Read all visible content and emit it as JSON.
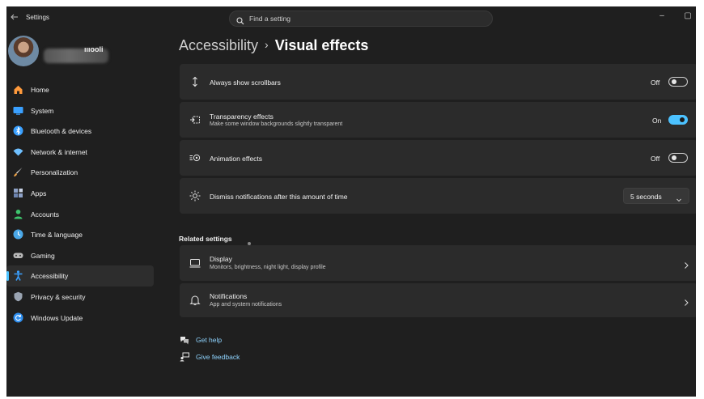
{
  "app": {
    "title": "Settings",
    "back_icon": "back-arrow-icon"
  },
  "search": {
    "placeholder": "Find a setting",
    "value": ""
  },
  "window_controls": {
    "minimize": "–",
    "maximize": "▢"
  },
  "user": {
    "name": "ıııooli"
  },
  "sidebar": {
    "items": [
      {
        "label": "Home",
        "icon": "home-icon",
        "color": "#ff9a3c"
      },
      {
        "label": "System",
        "icon": "system-icon",
        "color": "#3aa0ff"
      },
      {
        "label": "Bluetooth & devices",
        "icon": "bluetooth-icon",
        "color": "#3aa0ff"
      },
      {
        "label": "Network & internet",
        "icon": "network-icon",
        "color": "#6fc0ff"
      },
      {
        "label": "Personalization",
        "icon": "brush-icon",
        "color": "#f2a649"
      },
      {
        "label": "Apps",
        "icon": "apps-icon",
        "color": "#8ea2c8"
      },
      {
        "label": "Accounts",
        "icon": "accounts-icon",
        "color": "#3ec46d"
      },
      {
        "label": "Time & language",
        "icon": "time-language-icon",
        "color": "#4aa8e8"
      },
      {
        "label": "Gaming",
        "icon": "gaming-icon",
        "color": "#b8b8b8"
      },
      {
        "label": "Accessibility",
        "icon": "accessibility-icon",
        "color": "#3aa0ff",
        "active": true
      },
      {
        "label": "Privacy & security",
        "icon": "shield-icon",
        "color": "#9aa4b2"
      },
      {
        "label": "Windows Update",
        "icon": "update-icon",
        "color": "#2f8ff0"
      }
    ]
  },
  "breadcrumb": {
    "parent": "Accessibility",
    "separator": "›",
    "current": "Visual effects"
  },
  "settings": {
    "scrollbars": {
      "title": "Always show scrollbars",
      "state": "Off",
      "on": false
    },
    "transparency": {
      "title": "Transparency effects",
      "subtitle": "Make some window backgrounds slightly transparent",
      "state": "On",
      "on": true
    },
    "animation": {
      "title": "Animation effects",
      "state": "Off",
      "on": false
    },
    "notifications_timeout": {
      "title": "Dismiss notifications after this amount of time",
      "value": "5 seconds"
    }
  },
  "related": {
    "title": "Related settings",
    "items": [
      {
        "title": "Display",
        "subtitle": "Monitors, brightness, night light, display profile",
        "icon": "display-icon"
      },
      {
        "title": "Notifications",
        "subtitle": "App and system notifications",
        "icon": "bell-icon"
      }
    ]
  },
  "help": {
    "get_help": "Get help",
    "give_feedback": "Give feedback"
  },
  "colors": {
    "accent": "#4cc2ff",
    "background": "#1f1f1f",
    "card": "#2b2b2b"
  }
}
